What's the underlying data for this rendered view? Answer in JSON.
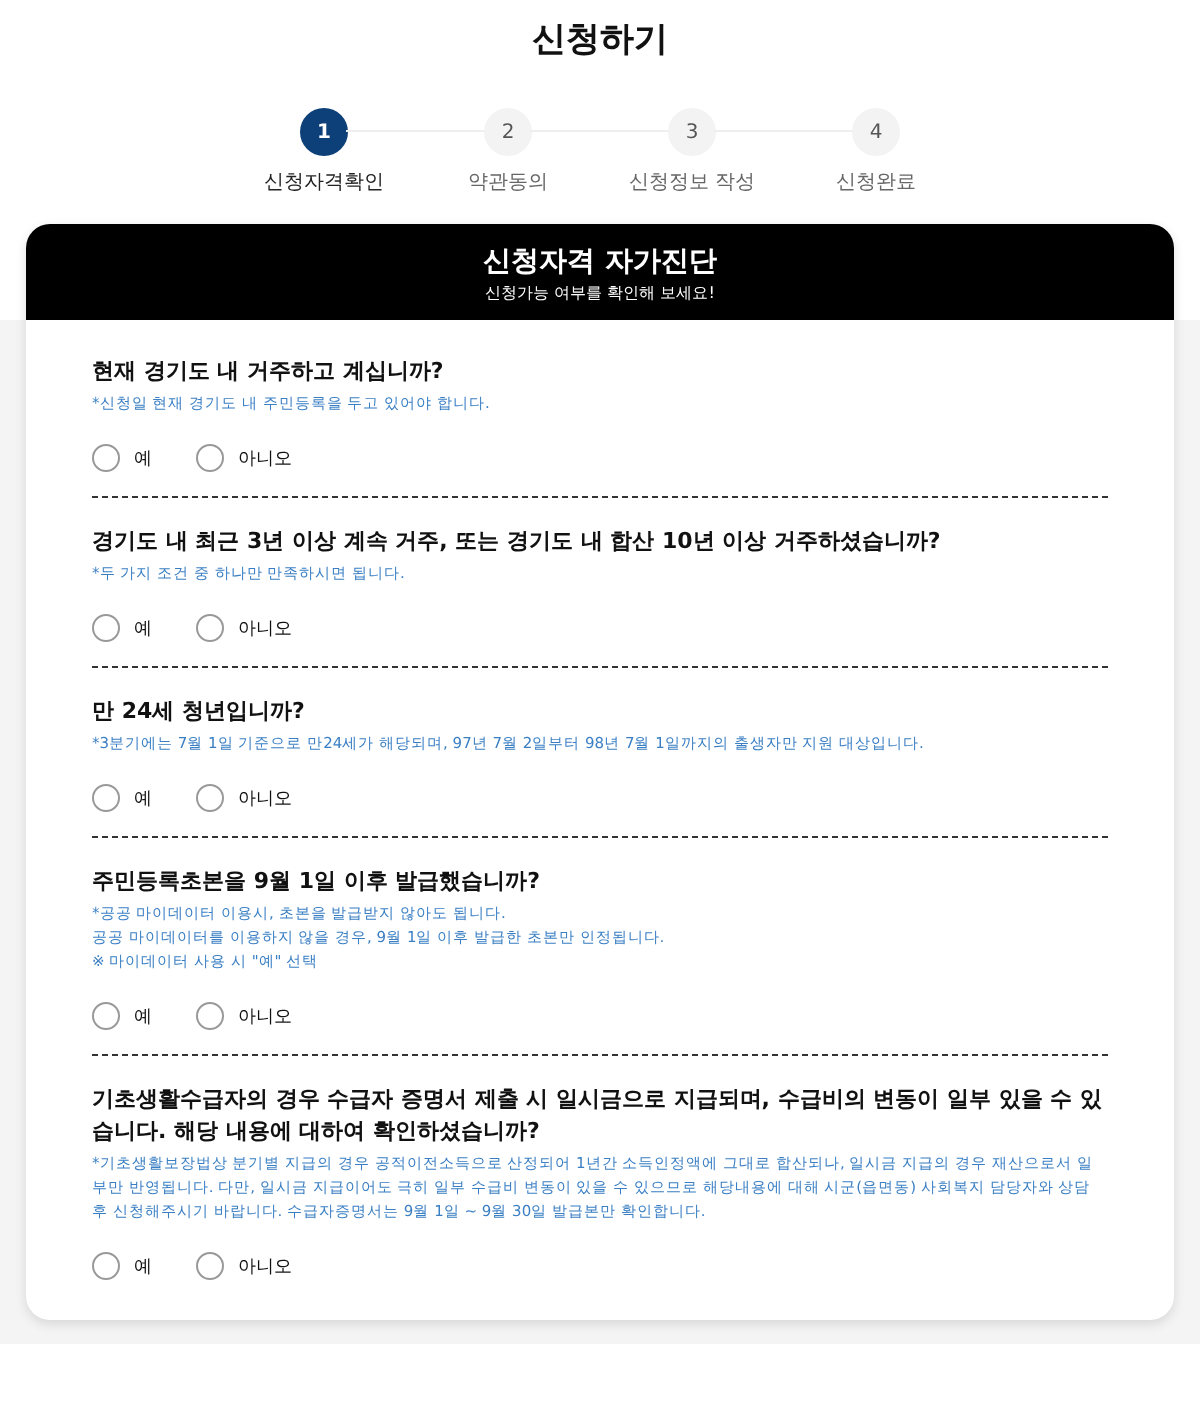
{
  "page_title": "신청하기",
  "steps": [
    {
      "number": "1",
      "label": "신청자격확인",
      "selected": true
    },
    {
      "number": "2",
      "label": "약관동의",
      "selected": false
    },
    {
      "number": "3",
      "label": "신청정보 작성",
      "selected": false
    },
    {
      "number": "4",
      "label": "신청완료",
      "selected": false
    }
  ],
  "card": {
    "title": "신청자격 자가진단",
    "subtitle": "신청가능 여부를 확인해 보세요!"
  },
  "questions": [
    {
      "question": "현재 경기도 내 거주하고 계십니까?",
      "note_lines": [
        "*신청일 현재 경기도 내 주민등록을 두고 있어야 합니다."
      ],
      "options": [
        {
          "label": "예",
          "selected": false
        },
        {
          "label": "아니오",
          "selected": false
        }
      ]
    },
    {
      "question": "경기도 내 최근 3년 이상 계속 거주, 또는 경기도 내 합산 10년 이상 거주하셨습니까?",
      "note_lines": [
        "*두 가지 조건 중 하나만 만족하시면 됩니다."
      ],
      "options": [
        {
          "label": "예",
          "selected": false
        },
        {
          "label": "아니오",
          "selected": false
        }
      ]
    },
    {
      "question": "만 24세 청년입니까?",
      "note_lines": [
        "*3분기에는 7월 1일 기준으로 만24세가 해당되며, 97년 7월 2일부터 98년 7월 1일까지의 출생자만 지원 대상입니다."
      ],
      "options": [
        {
          "label": "예",
          "selected": false
        },
        {
          "label": "아니오",
          "selected": false
        }
      ]
    },
    {
      "question": "주민등록초본을 9월 1일 이후 발급했습니까?",
      "note_lines": [
        "*공공 마이데이터 이용시, 초본을 발급받지 않아도 됩니다.",
        "공공 마이데이터를 이용하지 않을 경우, 9월 1일 이후 발급한 초본만 인정됩니다.",
        "※ 마이데이터 사용 시 \"예\" 선택"
      ],
      "options": [
        {
          "label": "예",
          "selected": false
        },
        {
          "label": "아니오",
          "selected": false
        }
      ]
    },
    {
      "question": "기초생활수급자의 경우 수급자 증명서 제출 시 일시금으로 지급되며, 수급비의 변동이 일부 있을 수 있습니다. 해당 내용에 대하여 확인하셨습니까?",
      "note_lines": [
        "*기초생활보장법상 분기별 지급의 경우 공적이전소득으로 산정되어 1년간 소득인정액에 그대로 합산되나, 일시금 지급의 경우 재산으로서 일부만 반영됩니다. 다만, 일시금 지급이어도 극히 일부 수급비 변동이 있을 수 있으므로 해당내용에 대해 시군(읍면동) 사회복지 담당자와 상담 후 신청해주시기 바랍니다. 수급자증명서는 9월 1일 ~ 9월 30일 발급본만 확인합니다."
      ],
      "options": [
        {
          "label": "예",
          "selected": false
        },
        {
          "label": "아니오",
          "selected": false
        }
      ]
    }
  ]
}
